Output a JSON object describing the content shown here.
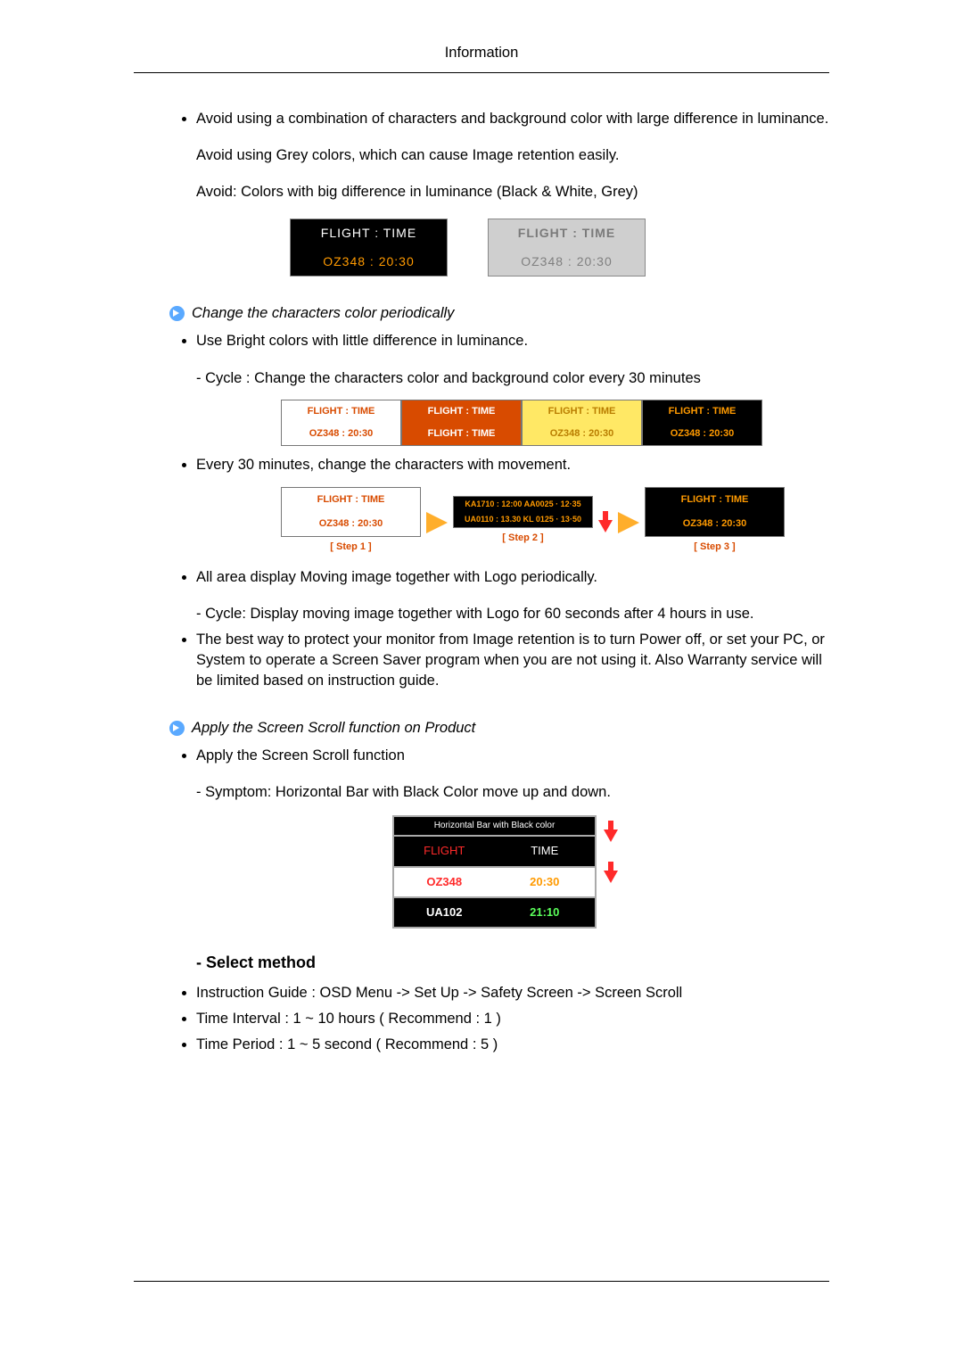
{
  "header": "Information",
  "bullets": {
    "avoid_combo": "Avoid using a combination of characters and background color with large difference in luminance.",
    "avoid_grey": "Avoid using Grey colors, which can cause Image retention easily.",
    "avoid_colors": "Avoid: Colors with big difference in luminance (Black & White, Grey)",
    "bright": "Use Bright colors with little difference in luminance.",
    "bright_sub": "- Cycle : Change the characters color and background color every 30 minutes",
    "movement": "Every 30 minutes, change the characters with movement.",
    "logo": "All area display Moving image together with Logo periodically.",
    "logo_sub": "- Cycle: Display moving image together with Logo for 60 seconds after 4 hours in use.",
    "protect": "The best way to protect your monitor from Image retention is to turn Power off, or set your PC, or System to operate a Screen Saver program when you are not using it. Also Warranty service will be limited based on instruction guide.",
    "apply_scroll": "Apply the Screen Scroll function",
    "apply_scroll_sub": "- Symptom: Horizontal Bar with Black Color move up and down."
  },
  "headings": {
    "change_chars": "Change the characters color periodically",
    "apply_scroll": "Apply the Screen Scroll function on Product"
  },
  "example_box": {
    "line1": "FLIGHT : TIME",
    "line2": "OZ348   : 20:30"
  },
  "four_boxes": {
    "c1_top": "FLIGHT : TIME",
    "c1_bot": "OZ348   : 20:30",
    "c2_top": "FLIGHT : TIME",
    "c2_bot": "FLIGHT : TIME",
    "c3_top": "FLIGHT  :  TIME",
    "c3_bot": "OZ348   : 20:30",
    "c4_top": "FLIGHT : TIME",
    "c4_bot": "OZ348   : 20:30"
  },
  "steps": {
    "s1a": "FLIGHT : TIME",
    "s1b": "OZ348   : 20:30",
    "s1l": "[ Step 1 ]",
    "s2a": "KA1710  :  12:00\nAA0025 · 12·35",
    "s2b": "UA0110  :  13.30\nKL 0125 · 13·50",
    "s2l": "[ Step 2 ]",
    "s3a": "FLIGHT : TIME",
    "s3b": "OZ348   : 20:30",
    "s3l": "[ Step 3 ]"
  },
  "scroll": {
    "hdr": "Horizontal Bar with Black color",
    "r0a": "FLIGHT",
    "r0b": "TIME",
    "r1a": "OZ348",
    "r1b": "20:30",
    "r2a": "UA102",
    "r2b": "21:10"
  },
  "select": {
    "head": "- Select method",
    "items": [
      "Instruction Guide : OSD Menu -> Set Up -> Safety Screen -> Screen Scroll",
      "Time Interval : 1 ~ 10 hours ( Recommend : 1 )",
      "Time Period : 1 ~ 5 second ( Recommend : 5 )"
    ]
  }
}
